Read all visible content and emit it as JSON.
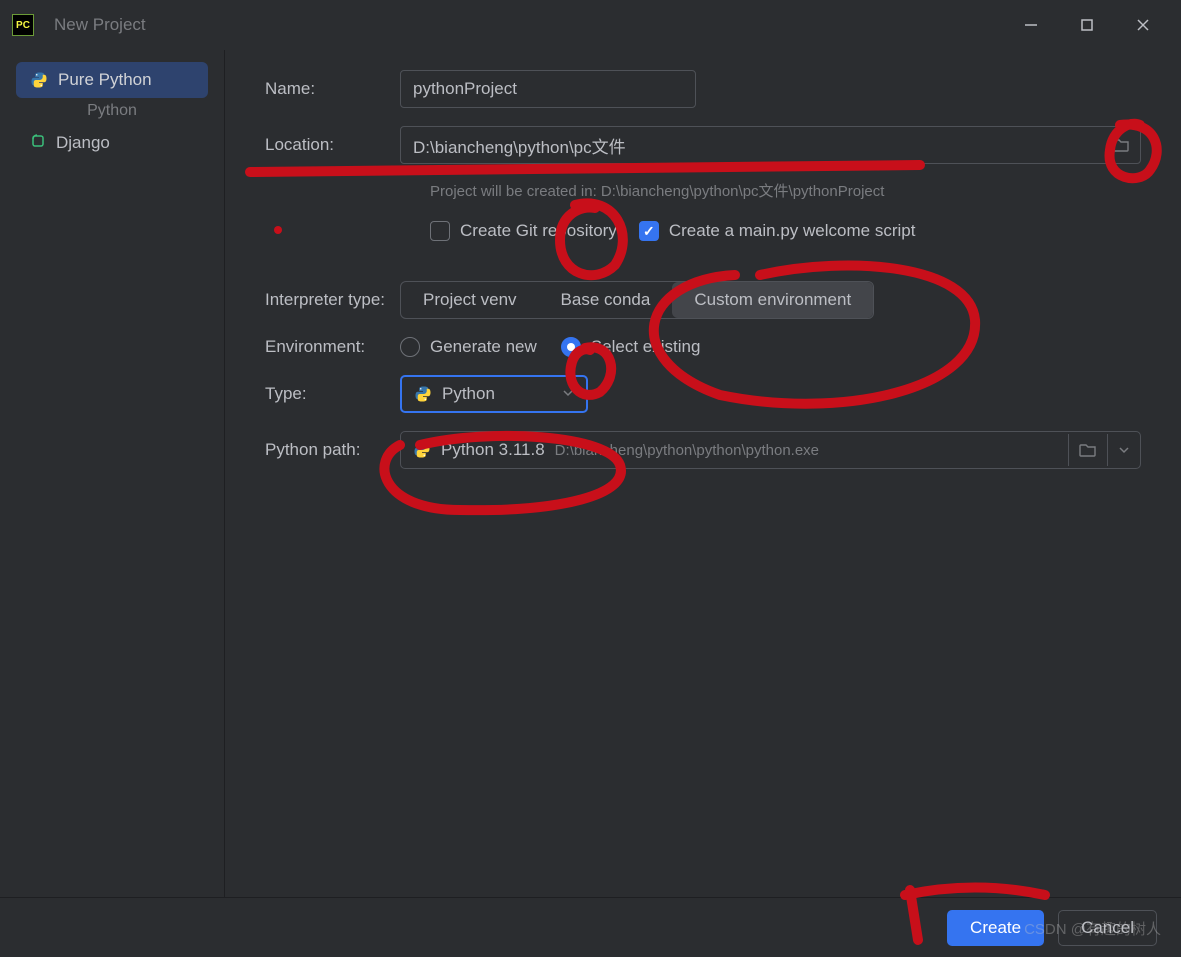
{
  "window": {
    "title": "New Project"
  },
  "sidebar": {
    "items": [
      {
        "label": "Pure Python"
      },
      {
        "category": "Python"
      },
      {
        "label": "Django"
      }
    ]
  },
  "form": {
    "name_label": "Name:",
    "name_value": "pythonProject",
    "location_label": "Location:",
    "location_value": "D:\\biancheng\\python\\pc文件",
    "created_in_prefix": "Project will be created in: ",
    "created_in_path": "D:\\biancheng\\python\\pc文件\\pythonProject",
    "git_label": "Create Git repository",
    "welcome_label": "Create a main.py welcome script",
    "interpreter_label": "Interpreter type:",
    "interpreter_options": [
      "Project venv",
      "Base conda",
      "Custom environment"
    ],
    "environment_label": "Environment:",
    "env_generate": "Generate new",
    "env_existing": "Select existing",
    "type_label": "Type:",
    "type_value": "Python",
    "python_path_label": "Python path:",
    "python_path_value": "Python 3.11.8",
    "python_path_hint": "D:\\biancheng\\python\\python\\python.exe"
  },
  "footer": {
    "create": "Create",
    "cancel": "Cancel"
  },
  "watermark": "CSDN @有趣的树人"
}
